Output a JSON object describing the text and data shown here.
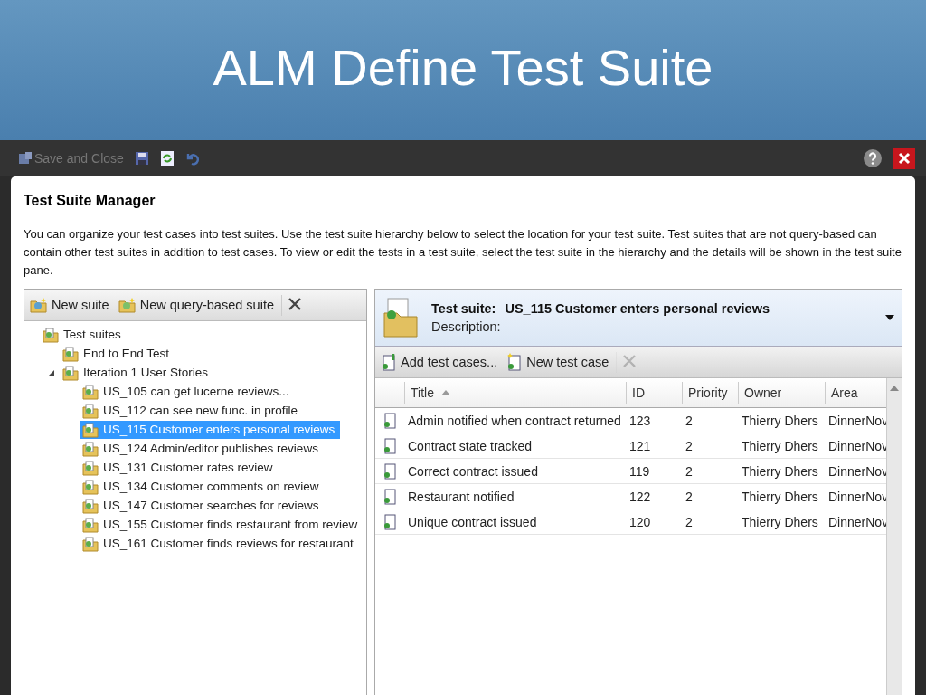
{
  "slide": {
    "title": "ALM Define Test Suite"
  },
  "toolbar": {
    "items": [
      {
        "kind": "save-close",
        "label": "Save and Close",
        "disabled": true
      },
      {
        "kind": "save",
        "disabled": false
      },
      {
        "kind": "refresh",
        "disabled": false
      },
      {
        "kind": "undo",
        "disabled": false
      }
    ]
  },
  "dialog": {
    "title": "Test Suite Manager",
    "intro": "You can organize your test cases into test suites. Use the test suite hierarchy below to select the location for your test suite. Test suites that are not query-based can contain other test suites in addition to test cases. To view or edit the tests in a test suite, select the test suite in the hierarchy and the details will be shown in the test suite pane."
  },
  "tree_toolbar": [
    {
      "kind": "new",
      "label": "New suite",
      "disabled": false
    },
    {
      "kind": "query",
      "label": "New query-based suite",
      "disabled": false
    },
    {
      "kind": "delete",
      "disabled": false
    }
  ],
  "tree": [
    {
      "label": "Test suites",
      "selected": false,
      "children": [
        {
          "label": "End to End Test",
          "selected": false
        },
        {
          "label": "Iteration 1 User Stories",
          "selected": false,
          "expanded": true,
          "children": [
            {
              "label": "US_105 can get lucerne reviews...",
              "selected": false
            },
            {
              "label": "US_112 can see new func. in profile",
              "selected": false
            },
            {
              "label": "US_115 Customer enters personal reviews",
              "selected": true
            },
            {
              "label": "US_124 Admin/editor publishes reviews",
              "selected": false
            },
            {
              "label": "US_131 Customer rates review",
              "selected": false
            },
            {
              "label": "US_134 Customer comments on review",
              "selected": false
            },
            {
              "label": "US_147 Customer searches for reviews",
              "selected": false
            },
            {
              "label": "US_155 Customer finds restaurant from review",
              "selected": false
            },
            {
              "label": "US_161 Customer finds reviews for restaurant",
              "selected": false
            }
          ]
        }
      ]
    }
  ],
  "suite": {
    "label": "Test suite:",
    "name": "US_115 Customer enters personal reviews",
    "description_label": "Description:"
  },
  "case_toolbar": [
    {
      "kind": "add",
      "label": "Add test cases...",
      "disabled": false
    },
    {
      "kind": "new",
      "label": "New test case",
      "disabled": false
    },
    {
      "kind": "delete",
      "disabled": true
    }
  ],
  "table": {
    "columns": [
      "Title",
      "ID",
      "Priority",
      "Owner",
      "Area"
    ],
    "rows": [
      [
        "Admin notified when contract returned",
        "123",
        "2",
        "Thierry Dhers",
        "DinnerNov"
      ],
      [
        "Contract state tracked",
        "121",
        "2",
        "Thierry Dhers",
        "DinnerNov"
      ],
      [
        "Correct contract issued",
        "119",
        "2",
        "Thierry Dhers",
        "DinnerNov"
      ],
      [
        "Restaurant notified",
        "122",
        "2",
        "Thierry Dhers",
        "DinnerNov"
      ],
      [
        "Unique contract issued",
        "120",
        "2",
        "Thierry Dhers",
        "DinnerNov"
      ]
    ]
  }
}
